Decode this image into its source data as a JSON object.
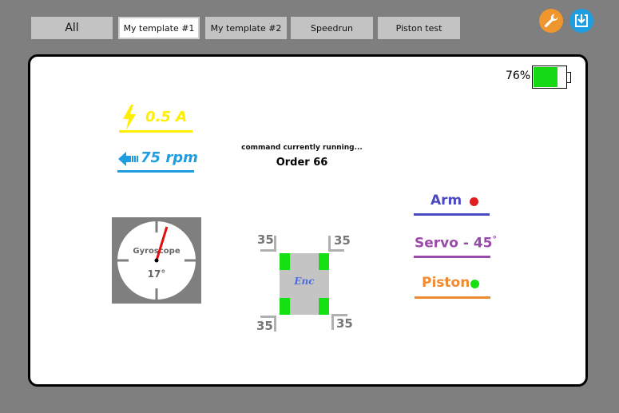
{
  "tabs": [
    {
      "label": "All",
      "active": false
    },
    {
      "label": "My template #1",
      "active": true
    },
    {
      "label": "My template #2",
      "active": false
    },
    {
      "label": "Speedrun",
      "active": false
    },
    {
      "label": "Piston test",
      "active": false
    }
  ],
  "toolbar": {
    "settings_icon": "wrench-icon",
    "download_icon": "download-icon",
    "accent_color": "#f0962e",
    "download_color": "#1e9ee0"
  },
  "battery": {
    "percent_label": "76%",
    "level": 0.76,
    "color": "#14d914"
  },
  "current": {
    "value": "0.5 A",
    "color": "#ffee00",
    "icon": "lightning-icon"
  },
  "speed": {
    "value": "75 rpm",
    "color": "#1e9ee0",
    "icon": "arrow-left-icon"
  },
  "command": {
    "label": "command currently running...",
    "value": "Order 66"
  },
  "gyroscope": {
    "label": "Gyroscope",
    "angle": "17°",
    "angle_deg": 17
  },
  "encoders": {
    "label": "Enc",
    "top_left": "35",
    "top_right": "35",
    "bottom_left": "35",
    "bottom_right": "35"
  },
  "mechanisms": {
    "arm": {
      "label": "Arm",
      "color": "#4a4ac0",
      "status_color": "#e02020"
    },
    "servo": {
      "label": "Servo - 45",
      "degree": "°",
      "color": "#9a4aa8"
    },
    "piston": {
      "label": "Piston",
      "color": "#f08a30",
      "status_color": "#14e014"
    }
  }
}
